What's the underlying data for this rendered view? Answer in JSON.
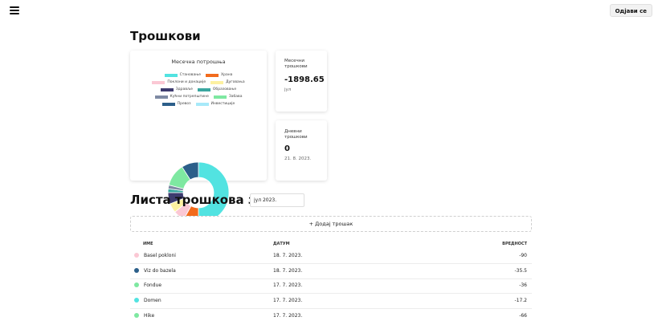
{
  "header": {
    "logout_label": "Одјави се"
  },
  "page": {
    "title": "Трошкови"
  },
  "chart_data": {
    "type": "pie",
    "title": "Месечна потрошња",
    "categories": [
      "Становање",
      "Храна",
      "Поклони и донације",
      "Дуговања",
      "Здравље",
      "Образовање",
      "Кућни потрепштине",
      "Забава",
      "Превоз",
      "Инвестиције"
    ],
    "values": [
      50,
      8,
      6,
      5,
      6,
      2,
      2,
      12,
      9,
      0
    ],
    "colors": [
      "#52e3e1",
      "#f26b1d",
      "#fbc8d4",
      "#fdf1a1",
      "#3d3b6e",
      "#3aa6a0",
      "#7e8aa3",
      "#7ee8a1",
      "#2c5f8a",
      "#a7e9f9"
    ],
    "legend_placement": "top"
  },
  "legend_rows": [
    [
      "Становање",
      "Храна"
    ],
    [
      "Поклони и донације",
      "Дуговања"
    ],
    [
      "Здравље",
      "Образовање"
    ],
    [
      "Кућни потрепштине",
      "Забава"
    ],
    [
      "Превоз",
      "Инвестиције"
    ]
  ],
  "stats": {
    "monthly": {
      "label": "Месечни трошкови",
      "value": "-1898.65",
      "sub": "јул"
    },
    "daily": {
      "label": "Дневни трошкови",
      "value": "0",
      "sub": "21. 8. 2023."
    }
  },
  "list": {
    "title": "Листа трошкова за",
    "month_value": "јул 2023.",
    "add_label": "+ Додај трошак",
    "columns": {
      "name": "ИМЕ",
      "date": "ДАТУМ",
      "value": "ВРЕДНОСТ"
    },
    "rows": [
      {
        "name": "Basel pokloni",
        "date": "18. 7. 2023.",
        "value": "-90",
        "color": "#fbc8d4"
      },
      {
        "name": "Viz do bazela",
        "date": "18. 7. 2023.",
        "value": "-35.5",
        "color": "#2c5f8a"
      },
      {
        "name": "Fondue",
        "date": "17. 7. 2023.",
        "value": "-36",
        "color": "#7ee8a1"
      },
      {
        "name": "Domen",
        "date": "17. 7. 2023.",
        "value": "-17.2",
        "color": "#52e3e1"
      },
      {
        "name": "Hike",
        "date": "17. 7. 2023.",
        "value": "-66",
        "color": "#7ee8a1"
      }
    ]
  }
}
